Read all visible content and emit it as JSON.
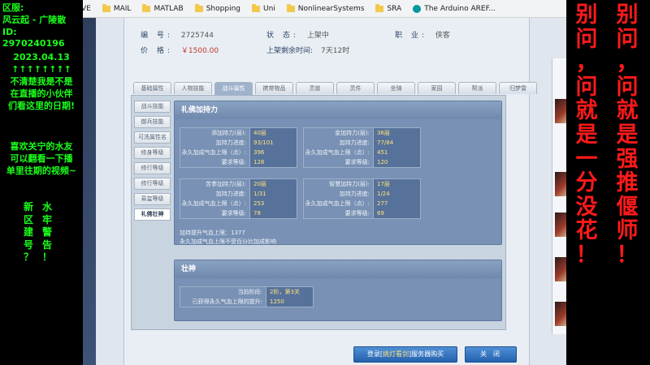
{
  "overlay_left": {
    "server": "区服:",
    "server_name": "风云起 - 广陵散",
    "id": "ID: 2970240196",
    "date": "2023.04.13",
    "arrows": "↑↑↑↑↑↑↑↑",
    "msg1_l1": "不清楚我是不是",
    "msg1_l2": "在直播的小伙伴",
    "msg1_l3": "们看这里的日期!",
    "msg2_l1": "喜欢关宁的水友",
    "msg2_l2": "可以翻看一下播",
    "msg2_l3": "单里往期的视频~",
    "col1": [
      "新",
      "区",
      "建",
      "号",
      "？"
    ],
    "col2": [
      "水",
      "牢",
      "警",
      "告",
      "！"
    ]
  },
  "overlay_right": {
    "col1": [
      "别",
      "问",
      "，",
      "问",
      "就",
      "是",
      "一",
      "分",
      "没",
      "花",
      "！"
    ],
    "col2": [
      "别",
      "问",
      "，",
      "问",
      "就",
      "是",
      "强",
      "推",
      "偃",
      "师",
      "！"
    ]
  },
  "bookmarks": [
    {
      "label": "VE",
      "icon": "none"
    },
    {
      "label": "MAIL",
      "icon": "folder-icon"
    },
    {
      "label": "MATLAB",
      "icon": "folder-icon"
    },
    {
      "label": "Shopping",
      "icon": "folder-icon"
    },
    {
      "label": "Uni",
      "icon": "folder-icon"
    },
    {
      "label": "NonlinearSystems",
      "icon": "folder-icon"
    },
    {
      "label": "SRA",
      "icon": "folder-icon"
    },
    {
      "label": "The Arduino AREF...",
      "icon": "arduino-icon"
    }
  ],
  "info": {
    "id_label": "编 号:",
    "id_value": "2725744",
    "status_label": "状 态:",
    "status_value": "上架中",
    "job_label": "职 业:",
    "job_value": "侠客",
    "price_label": "价 格:",
    "price_value": "￥1500.00",
    "time_label": "上架剩余时间:",
    "time_value": "7天12时"
  },
  "tabs": [
    "基础属性",
    "人物技能",
    "战斗属性",
    "携带物品",
    "灵兽",
    "灵件",
    "坐骑",
    "家园",
    "帮派",
    "归梦雷"
  ],
  "active_tab": 2,
  "subnav": [
    "战斗技能",
    "御兵技能",
    "可洗属性名",
    "修身等级",
    "修行等级",
    "修行等级",
    "易玺等级",
    "礼佛壮神"
  ],
  "active_sub": 7,
  "section1": {
    "title": "礼佛加持力",
    "blocks": [
      {
        "rows": [
          [
            "添加持力(层):",
            "40层"
          ],
          [
            "加持力进度:",
            "93/101"
          ],
          [
            "永久加成气血上限（点）:",
            "396"
          ],
          [
            "要求等级:",
            "128"
          ]
        ]
      },
      {
        "rows": [
          [
            "金加持力(层):",
            "36层"
          ],
          [
            "加持力进度:",
            "77/84"
          ],
          [
            "永久加成气血上限（点）:",
            "451"
          ],
          [
            "要求等级:",
            "120"
          ]
        ]
      },
      {
        "rows": [
          [
            "苦参加持力(层):",
            "20层"
          ],
          [
            "加持力进度:",
            "1/31"
          ],
          [
            "永久加成气血上限（点）:",
            "253"
          ],
          [
            "要求等级:",
            "78"
          ]
        ]
      },
      {
        "rows": [
          [
            "智慧加持力(层):",
            "17层"
          ],
          [
            "加持力进度:",
            "1/24"
          ],
          [
            "永久加成气血上限（点）:",
            "277"
          ],
          [
            "要求等级:",
            "69"
          ]
        ]
      }
    ],
    "total": "加持提升气血上限：1377",
    "note": "永久加成气血上限不受百分比加成影响"
  },
  "section2": {
    "title": "壮神",
    "rows": [
      [
        "当前阶段:",
        "2阶，第3关"
      ],
      [
        "已获得永久气血上限的提升:",
        "1250"
      ]
    ]
  },
  "buttons": {
    "buy_prefix": "登录[",
    "buy_mid": "挑灯看剑",
    "buy_suffix": "]服务器购买",
    "close": "关闭"
  }
}
